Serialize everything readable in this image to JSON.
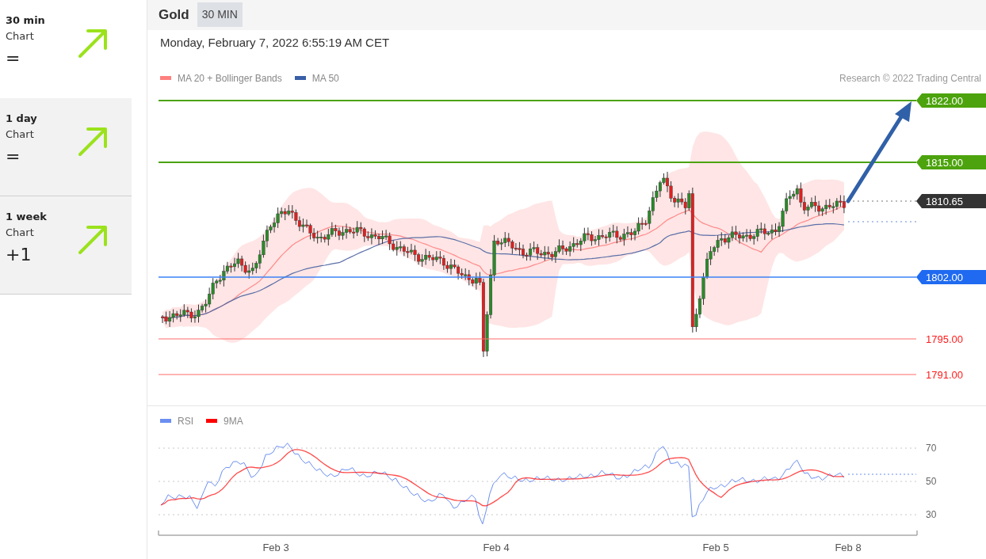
{
  "sidebar": {
    "items": [
      {
        "period": "30 min",
        "label": "Chart",
        "score": "=",
        "selected": true
      },
      {
        "period": "1 day",
        "label": "Chart",
        "score": "=",
        "selected": false
      },
      {
        "period": "1 week",
        "label": "Chart",
        "score": "+1",
        "selected": false
      }
    ]
  },
  "header": {
    "title": "Gold",
    "timeframe": "30 MIN"
  },
  "timestamp": "Monday, February 7, 2022 6:55:19 AM CET",
  "price_chart": {
    "legend": [
      {
        "label": "MA 20 + Bollinger Bands",
        "color": "#ff8080"
      },
      {
        "label": "MA 50",
        "color": "#3a5fa8"
      }
    ],
    "credit": "Research © 2022 Trading Central",
    "levels": [
      {
        "value": "1822.00",
        "kind": "resistance"
      },
      {
        "value": "1815.00",
        "kind": "resistance"
      },
      {
        "value": "1810.65",
        "kind": "last"
      },
      {
        "value": "1802.00",
        "kind": "pivot"
      },
      {
        "value": "1795.00",
        "kind": "support"
      },
      {
        "value": "1791.00",
        "kind": "support"
      }
    ]
  },
  "rsi_chart": {
    "legend": [
      {
        "label": "RSI",
        "color": "#6b8ef0"
      },
      {
        "label": "9MA",
        "color": "#ff0000"
      }
    ],
    "y_labels": [
      "70",
      "50",
      "30"
    ],
    "x_labels": [
      "Feb 3",
      "Feb 4",
      "Feb 5",
      "Feb 8"
    ]
  }
}
